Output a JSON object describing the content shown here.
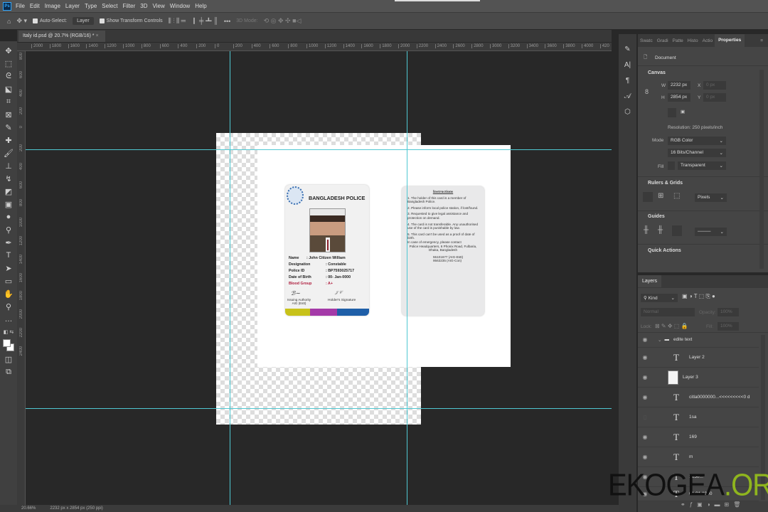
{
  "menu": {
    "app_icon": "Ps",
    "items": [
      "File",
      "Edit",
      "Image",
      "Layer",
      "Type",
      "Select",
      "Filter",
      "3D",
      "View",
      "Window",
      "Help"
    ]
  },
  "options": {
    "auto_select": "Auto-Select:",
    "auto_select_target": "Layer",
    "show_transform": "Show Transform Controls",
    "mode_3d": "3D Mode:"
  },
  "document_tab": {
    "title": "Italy id.psd @ 20.7% (RGB/16) *",
    "close": "×"
  },
  "rulers": {
    "horizontal": [
      "2000",
      "1800",
      "1600",
      "1400",
      "1200",
      "1000",
      "800",
      "600",
      "400",
      "200",
      "0",
      "200",
      "400",
      "600",
      "800",
      "1000",
      "1200",
      "1400",
      "1600",
      "1800",
      "2000",
      "2200",
      "2400",
      "2600",
      "2800",
      "3000",
      "3200",
      "3400",
      "3600",
      "3800",
      "4000",
      "420"
    ],
    "vertical": [
      "800",
      "600",
      "400",
      "200",
      "0",
      "200",
      "400",
      "600",
      "800",
      "1000",
      "1200",
      "1400",
      "1600",
      "1800",
      "2000",
      "2200",
      "2400"
    ]
  },
  "card_front": {
    "title": "BANGLADESH POLICE",
    "fields": [
      {
        "label": "Name",
        "value": ": John Citizen William"
      },
      {
        "label": "Designation",
        "value": ": Constable"
      },
      {
        "label": "Police ID",
        "value": ": BP7593025717"
      },
      {
        "label": "Date of Birth",
        "value": ": 00- Jan-0000"
      },
      {
        "label": "Blood Group",
        "value": ": A+"
      }
    ],
    "issuing": "Issuing Authority\nAIG (Estt)",
    "holder": "Holder's Signature"
  },
  "card_back": {
    "title": "Instructions",
    "items": [
      "1. The holder of this card is a member of Bangladesh Police.",
      "2. Please inform local police station, if lost/found.",
      "3. Requested to give legal assistance and protection on demand.",
      "4. The card is not transferable. Any unauthorised use of the card is punishable by law.",
      "5. This card can't be used as a proof of date of birth."
    ],
    "emergency": "In case of emergency, please contact",
    "address": "Police Headquarters, 6 Phonix Road, Fulbaria, Dhaka, Bangladesh",
    "phones": "55101677 (AIG-Estt)\n9563235 (AIG-Con)"
  },
  "status": {
    "zoom": "20.66%",
    "info": "2232 px x 2854 px (250 ppi)"
  },
  "properties": {
    "tabs": [
      "Swatc",
      "Gradi",
      "Patte",
      "Histo",
      "Actio",
      "Properties"
    ],
    "document": "Document",
    "canvas": "Canvas",
    "w_label": "W",
    "w": "2232 px",
    "h_label": "H",
    "h": "2854 px",
    "x_label": "X",
    "x": "0 px",
    "y_label": "Y",
    "y": "0 px",
    "resolution": "Resolution: 250 pixels/inch",
    "mode_label": "Mode",
    "mode": "RGB Color",
    "depth": "16 Bits/Channel",
    "fill_label": "Fill",
    "fill": "Transparent",
    "rulers_grids": "Rulers & Grids",
    "units": "Pixels",
    "guides": "Guides",
    "quick_actions": "Quick Actions"
  },
  "layers": {
    "tab": "Layers",
    "kind": "Kind",
    "blend": "Normal",
    "opacity_label": "Opacity:",
    "opacity": "100%",
    "lock_label": "Lock:",
    "fill_label": "Fill:",
    "fill": "100%",
    "items": [
      {
        "name": "edite text",
        "type": "group"
      },
      {
        "name": "Layer 2",
        "type": "text"
      },
      {
        "name": "Layer 3",
        "type": "image"
      },
      {
        "name": "citla0000000...<<<<<<<<<0 d",
        "type": "text"
      },
      {
        "name": "1sa",
        "type": "text"
      },
      {
        "name": "169",
        "type": "text"
      },
      {
        "name": "m",
        "type": "text"
      },
      {
        "name": "1250...",
        "type": "text"
      },
      {
        "name": "01.01.1990",
        "type": "text"
      }
    ]
  },
  "watermark": {
    "main": "EKOGEA",
    "suffix": ".ORG"
  },
  "colors": {
    "guide": "#4fc8d2",
    "accent": "#31a8ff",
    "watermark_green": "#8fb51e"
  }
}
